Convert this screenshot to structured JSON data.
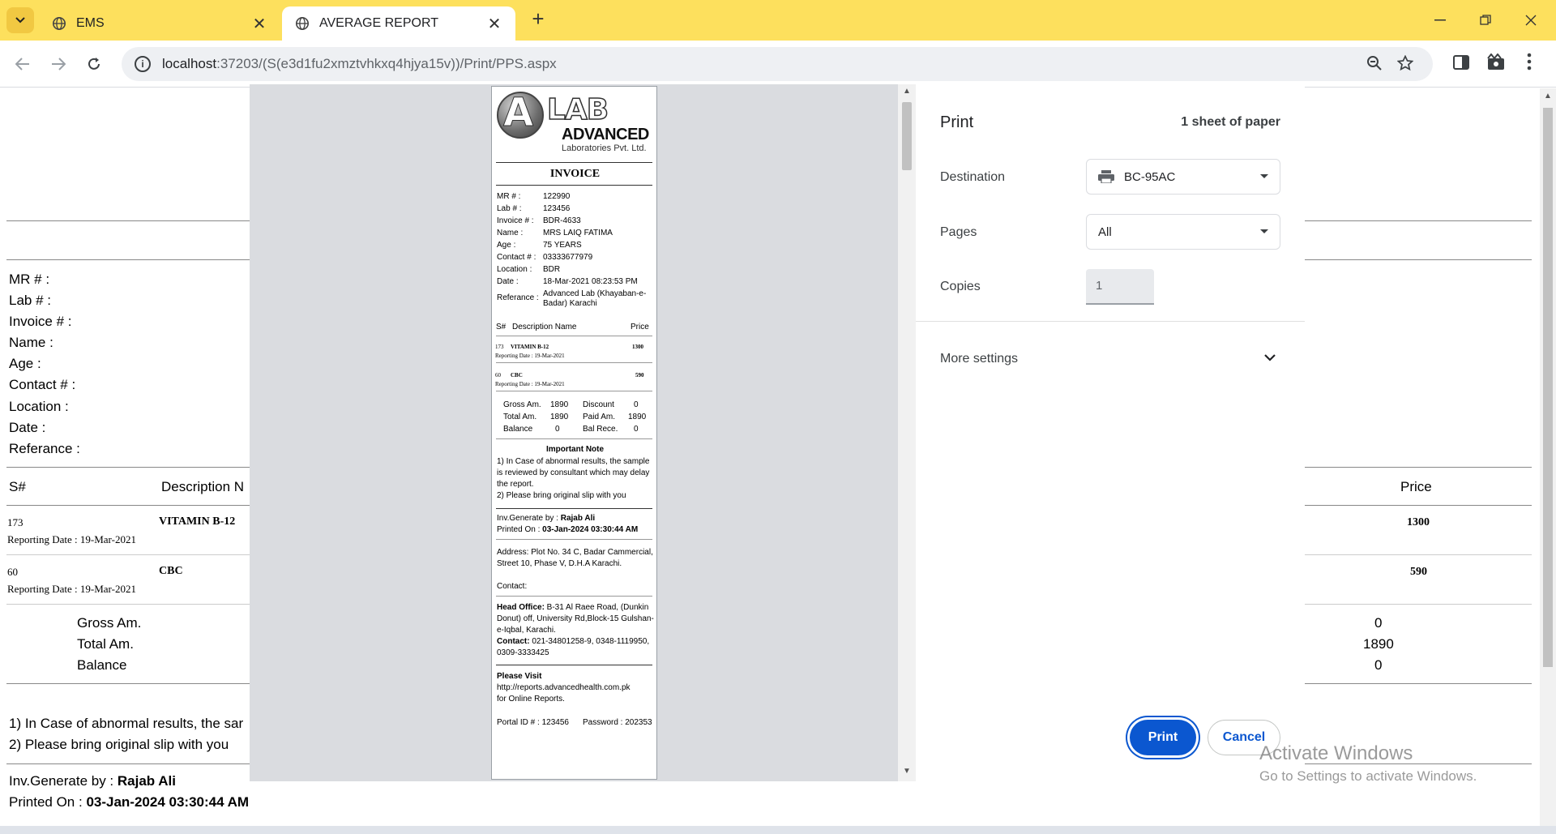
{
  "browser": {
    "tabs": [
      {
        "title": "EMS",
        "active": false
      },
      {
        "title": "AVERAGE REPORT",
        "active": true
      }
    ],
    "url_host": "localhost",
    "url_path": ":37203/(S(e3d1fu2xmztvhkxq4hjya15v))/Print/PPS.aspx"
  },
  "page": {
    "labels": [
      "MR # :",
      "Lab # :",
      "Invoice # :",
      "Name :",
      "Age :",
      "Contact # :",
      "Location :",
      "Date :",
      "Referance :"
    ],
    "table_headers": {
      "sno": "S#",
      "description": "Description N",
      "price": "Price"
    },
    "rows": [
      {
        "sno": "173",
        "test": "VITAMIN B-12",
        "reporting": "Reporting Date : 19-Mar-2021",
        "price": "1300"
      },
      {
        "sno": "60",
        "test": "CBC",
        "reporting": "Reporting Date : 19-Mar-2021",
        "price": "590"
      }
    ],
    "summary": [
      {
        "label": "Gross Am.",
        "value": "0"
      },
      {
        "label": "Total Am.",
        "value": "1890"
      },
      {
        "label": "Balance",
        "value": "0"
      }
    ],
    "notes": [
      "1) In Case of abnormal results, the sar",
      "2) Please bring original slip with you"
    ],
    "generated_by_label": "Inv.Generate by : ",
    "generated_by": "Rajab Ali",
    "printed_on_label": "Printed On : ",
    "printed_on": "03-Jan-2024 03:30:44 AM"
  },
  "receipt": {
    "logo_a": "A",
    "logo_lab": "LAB",
    "logo_advanced": "ADVANCED",
    "logo_sub": "Laboratories Pvt. Ltd.",
    "title": "INVOICE",
    "fields": [
      {
        "k": "MR # :",
        "v": "122990"
      },
      {
        "k": "Lab # :",
        "v": "123456"
      },
      {
        "k": "Invoice # :",
        "v": "BDR-4633"
      },
      {
        "k": "Name :",
        "v": "MRS LAIQ FATIMA"
      },
      {
        "k": "Age :",
        "v": "75 YEARS"
      },
      {
        "k": "Contact # :",
        "v": "03333677979"
      },
      {
        "k": "Location :",
        "v": "BDR"
      },
      {
        "k": "Date :",
        "v": "18-Mar-2021 08:23:53 PM"
      },
      {
        "k": "Referance :",
        "v": "Advanced Lab (Khayaban-e-Badar) Karachi"
      }
    ],
    "headers": {
      "sno": "S#",
      "desc": "Description Name",
      "price": "Price"
    },
    "rows": [
      {
        "sno": "173",
        "test": "VITAMIN B-12",
        "price": "1300",
        "reporting": "Reporting Date : 19-Mar-2021"
      },
      {
        "sno": "60",
        "test": "CBC",
        "price": "590",
        "reporting": "Reporting Date : 19-Mar-2021"
      }
    ],
    "totals": [
      {
        "k1": "Gross Am.",
        "v1": "1890",
        "k2": "Discount",
        "v2": "0"
      },
      {
        "k1": "Total Am.",
        "v1": "1890",
        "k2": "Paid Am.",
        "v2": "1890"
      },
      {
        "k1": "Balance",
        "v1": "0",
        "k2": "Bal Rece.",
        "v2": "0"
      }
    ],
    "note_title": "Important Note",
    "note_1": "1) In Case of abnormal results, the sample is reviewed by consultant which may delay the report.",
    "note_2": "2) Please bring original slip with you",
    "gen_label": "Inv.Generate by : ",
    "gen_by": "Rajab Ali",
    "printed_label": "Printed On : ",
    "printed_on": "03-Jan-2024 03:30:44 AM",
    "address": "Address: Plot No. 34 C, Badar Cammercial, Street 10, Phase V, D.H.A Karachi.",
    "contact_line": "Contact:",
    "head_office_label": "Head Office:",
    "head_office": " B-31 Al Raee Road, (Dunkin Donut) off, University Rd,Block-15 Gulshan-e-Iqbal, Karachi.",
    "ho_contact_label": "Contact:",
    "ho_contact": " 021-34801258-9, 0348-1119950, 0309-3333425",
    "visit_title": "Please Visit",
    "visit_url": "http://reports.advancedhealth.com.pk",
    "visit_suffix": "for Online Reports.",
    "portal": "Portal ID # : 123456",
    "password": "Password : 202353"
  },
  "print_dialog": {
    "title": "Print",
    "sheets": "1 sheet of paper",
    "destination_label": "Destination",
    "destination_value": "BC-95AC",
    "pages_label": "Pages",
    "pages_value": "All",
    "copies_label": "Copies",
    "copies_value": "1",
    "more_settings": "More settings",
    "print_button": "Print",
    "cancel_button": "Cancel"
  },
  "watermark": {
    "line1": "Activate Windows",
    "line2": "Go to Settings to activate Windows."
  },
  "colors": {
    "tabbar": "#fde05d",
    "primary_button": "#0b57d0"
  }
}
